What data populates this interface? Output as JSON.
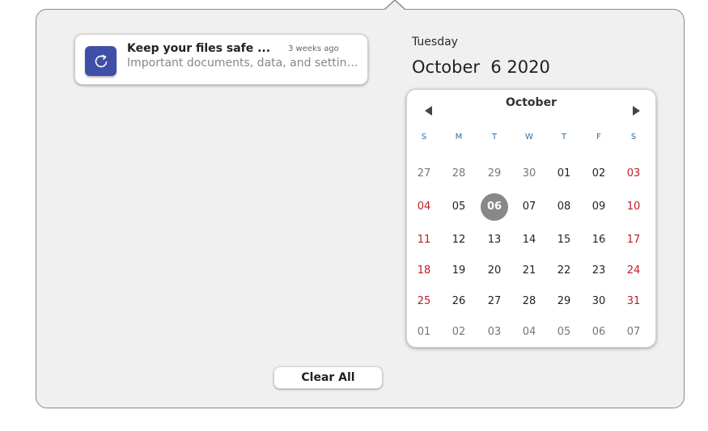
{
  "notification": {
    "icon": "sync-icon",
    "icon_color": "#3f4ea6",
    "title": "Keep your files safe ...",
    "time": "3 weeks ago",
    "body": "Important documents, data, and settings can be backed up"
  },
  "date_header": {
    "day_name": "Tuesday",
    "full_date": "October  6 2020"
  },
  "calendar": {
    "month": "October",
    "prev_icon": "triangle-left-icon",
    "next_icon": "triangle-right-icon",
    "weekdays": [
      "S",
      "M",
      "T",
      "W",
      "T",
      "F",
      "S"
    ],
    "weeks": [
      [
        "27",
        "28",
        "29",
        "30",
        "01",
        "02",
        "03"
      ],
      [
        "04",
        "05",
        "06",
        "07",
        "08",
        "09",
        "10"
      ],
      [
        "11",
        "12",
        "13",
        "14",
        "15",
        "16",
        "17"
      ],
      [
        "18",
        "19",
        "20",
        "21",
        "22",
        "23",
        "24"
      ],
      [
        "25",
        "26",
        "27",
        "28",
        "29",
        "30",
        "31"
      ],
      [
        "01",
        "02",
        "03",
        "04",
        "05",
        "06",
        "07"
      ]
    ],
    "today": "06",
    "weekend_color": "#c01c28",
    "today_color": "#888888"
  },
  "clear_all_label": "Clear All"
}
